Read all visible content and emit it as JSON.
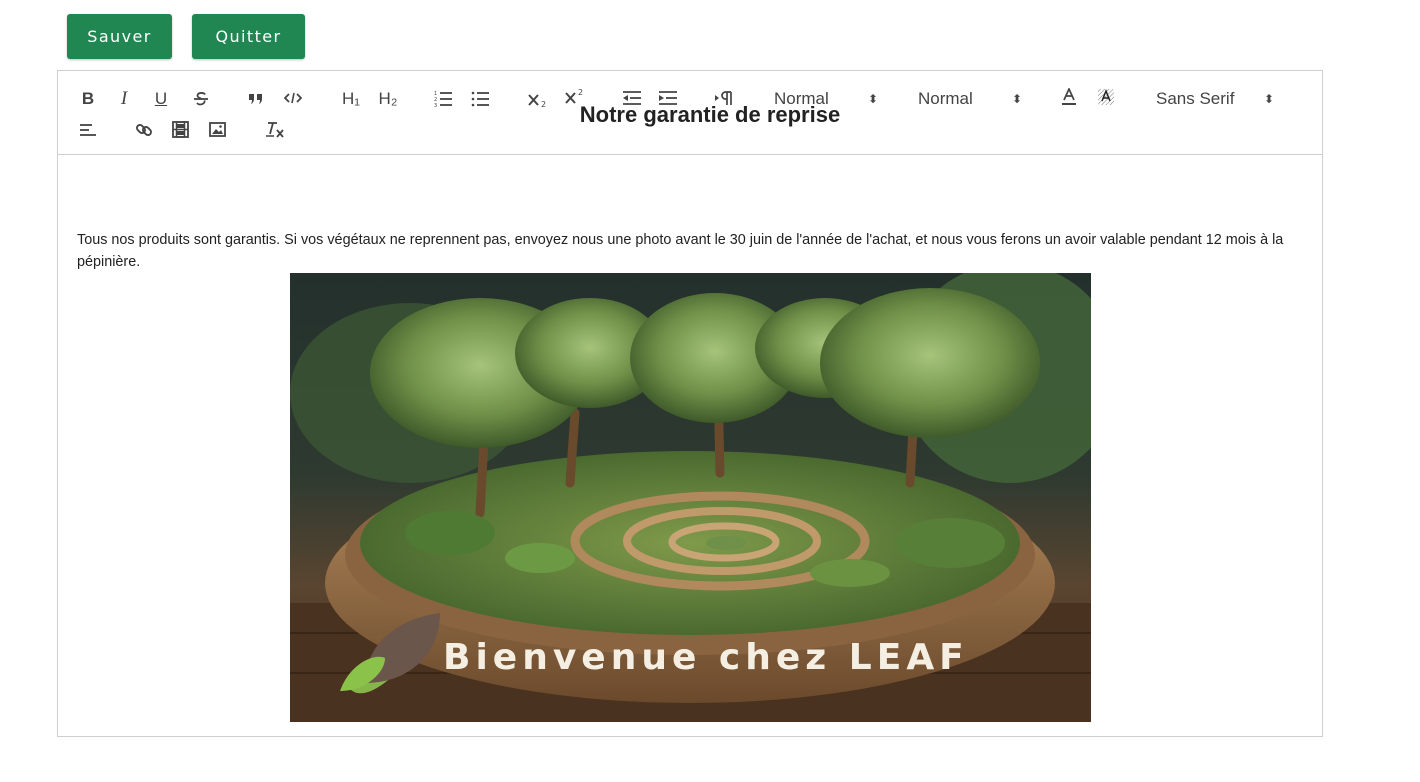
{
  "actions": {
    "save_label": "Sauver",
    "quit_label": "Quitter"
  },
  "colors": {
    "button_green": "#218752",
    "border": "#cfcfcf"
  },
  "toolbar": {
    "bold": "B",
    "italic": "I",
    "underline": "U",
    "h1": "H₁",
    "h2": "H₂",
    "header_picker": "Normal",
    "size_picker": "Normal",
    "font_picker": "Sans Serif",
    "icons": [
      "bold-icon",
      "italic-icon",
      "underline-icon",
      "strike-icon",
      "blockquote-icon",
      "code-block-icon",
      "h1-icon",
      "h2-icon",
      "ordered-list-icon",
      "bullet-list-icon",
      "subscript-icon",
      "superscript-icon",
      "outdent-icon",
      "indent-icon",
      "direction-icon",
      "text-color-icon",
      "background-color-icon",
      "align-icon",
      "link-icon",
      "video-icon",
      "image-icon",
      "clean-format-icon"
    ]
  },
  "document": {
    "title": "Notre garantie de reprise",
    "paragraph": "Tous nos produits sont garantis. Si vos végétaux ne reprennent pas, envoyez nous une photo avant le 30 juin de l'année de l'achat, et nous vous ferons un avoir valable pendant 12 mois à la pépinière.",
    "image_caption": "Bienvenue chez LEAF"
  }
}
